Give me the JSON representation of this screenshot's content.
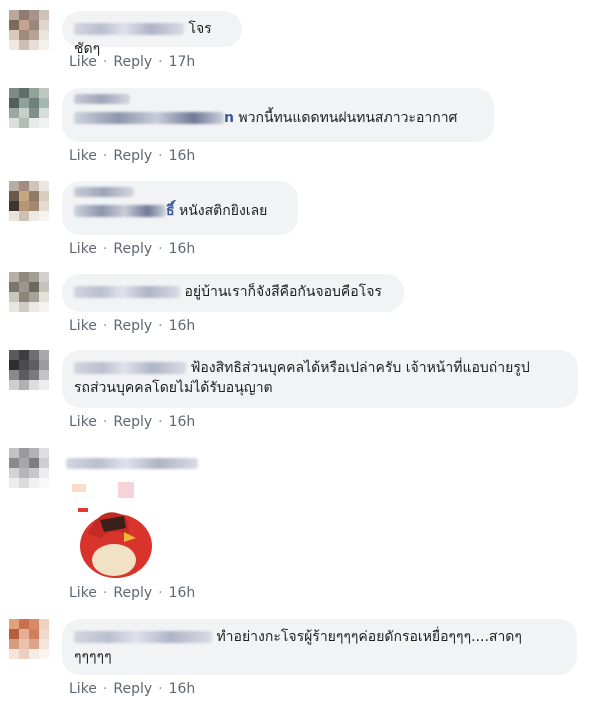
{
  "comments": [
    {
      "name_tail": "",
      "text": "โจรชัดๆ",
      "like": "Like",
      "reply": "Reply",
      "time": "17h"
    },
    {
      "name_tail": "n",
      "text": "พวกนี้ทนแดดทนฝนทนสภาวะอากาศ",
      "like": "Like",
      "reply": "Reply",
      "time": "16h"
    },
    {
      "name_tail": "ธิ์",
      "text": "หนังสติกยิงเลย",
      "like": "Like",
      "reply": "Reply",
      "time": "16h"
    },
    {
      "name_tail": "",
      "text": "อยู่บ้านเราก็จังสีคือกันจอบคือโจร",
      "like": "Like",
      "reply": "Reply",
      "time": "16h"
    },
    {
      "name_tail": "",
      "text": "ฟ้องสิทธิส่วนบุคคลได้หรือเปล่าครับ เจ้าหน้าที่แอบถ่ายรูป",
      "text2": "รถส่วนบุคคลโดยไม่ได้รับอนุญาต",
      "like": "Like",
      "reply": "Reply",
      "time": "16h"
    },
    {
      "name_tail": "",
      "text": "",
      "like": "Like",
      "reply": "Reply",
      "time": "16h"
    },
    {
      "name_tail": "",
      "text": "ทำอย่างกะโจรผู้ร้ายๆๆๆค่อยดักรอเหยื่อๆๆๆ....สาดๆ",
      "text2": "ๆๆๆๆๆ",
      "like": "Like",
      "reply": "Reply",
      "time": "16h"
    }
  ],
  "separator": "·",
  "icons": {
    "sticker": "red-bird-facepalm-sticker"
  }
}
